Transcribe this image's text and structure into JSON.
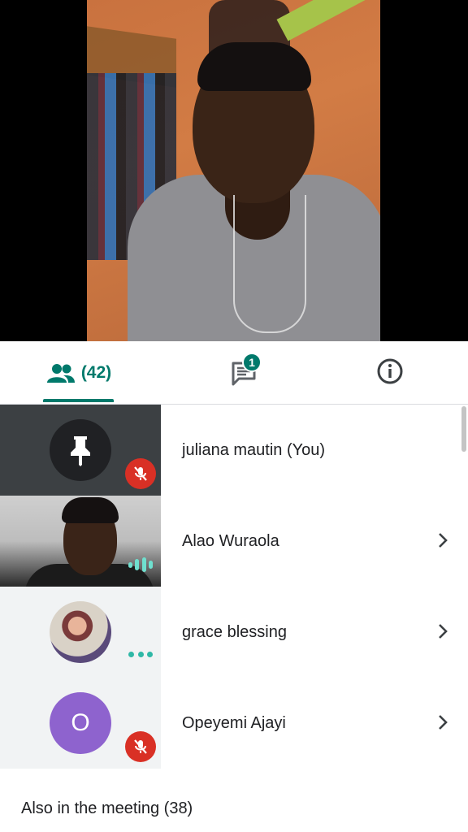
{
  "tabs": {
    "people": {
      "icon": "people-icon",
      "count_label": "(42)"
    },
    "chat": {
      "icon": "chat-icon",
      "badge": "1"
    },
    "info": {
      "icon": "info-icon"
    },
    "accent_color": "#00796b"
  },
  "participants": [
    {
      "name": "juliana mautin (You)",
      "avatar": "pin-icon",
      "muted": true,
      "has_chevron": false
    },
    {
      "name": "Alao Wuraola",
      "avatar": "video-feed",
      "muted": false,
      "speaking": true,
      "has_chevron": true
    },
    {
      "name": "grace blessing",
      "avatar": "photo",
      "muted": false,
      "activity": "more-dots",
      "has_chevron": true
    },
    {
      "name": "Opeyemi Ajayi",
      "avatar_letter": "O",
      "avatar_color": "#8e63ce",
      "muted": true,
      "has_chevron": true
    }
  ],
  "also_in_meeting": "Also in the meeting (38)",
  "colors": {
    "mute_red": "#d93025",
    "active_teal": "#2fb8a6"
  }
}
